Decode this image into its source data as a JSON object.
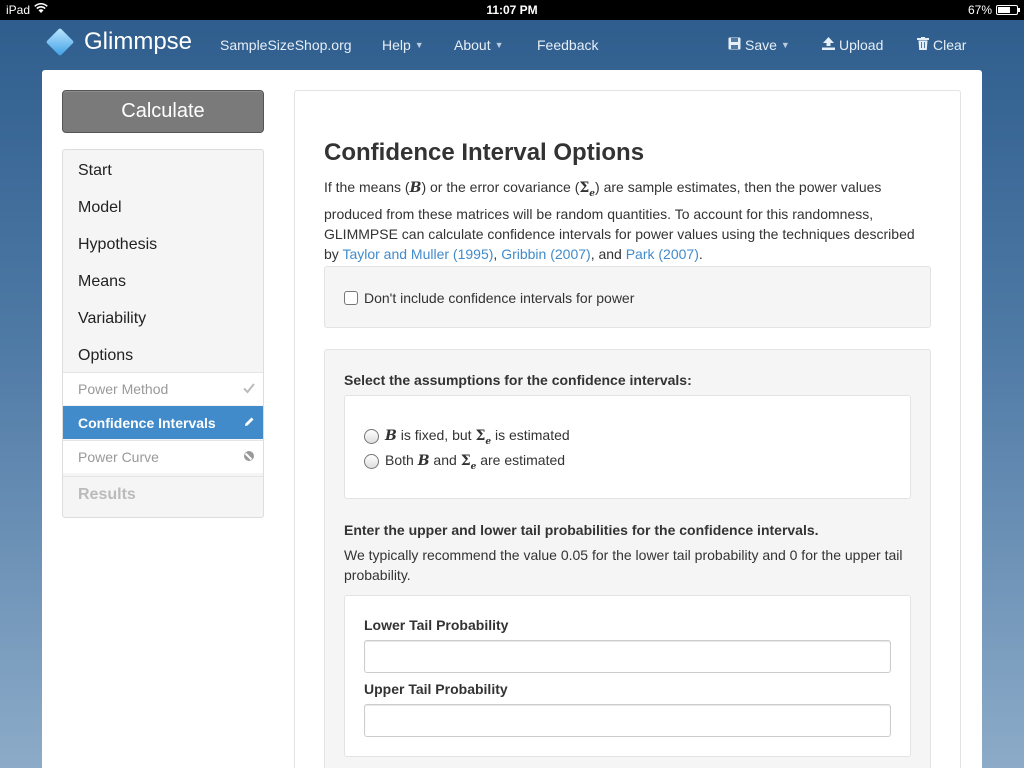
{
  "status_bar": {
    "device": "iPad",
    "time": "11:07 PM",
    "battery": "67%",
    "battery_level": 0.67
  },
  "navbar": {
    "brand": "Glimmpse",
    "links": {
      "site": "SampleSizeShop.org",
      "help": "Help",
      "about": "About",
      "feedback": "Feedback"
    },
    "actions": {
      "save": "Save",
      "upload": "Upload",
      "clear": "Clear"
    }
  },
  "sidebar": {
    "calculate": "Calculate",
    "items": [
      "Start",
      "Model",
      "Hypothesis",
      "Means",
      "Variability",
      "Options"
    ],
    "subitems": {
      "power_method": "Power Method",
      "confidence_intervals": "Confidence Intervals",
      "power_curve": "Power Curve"
    },
    "results": "Results"
  },
  "main": {
    "title": "Confidence Interval Options",
    "intro": {
      "p1": "If the means (",
      "b": "B",
      "p2": ") or the error covariance (",
      "sigma": "Σ",
      "e": "e",
      "p3": ") are sample estimates, then the power values produced from these matrices will be random quantities. To account for this randomness, GLIMMPSE can calculate confidence intervals for power values using the techniques described by ",
      "link1": "Taylor and Muller (1995)",
      "sep1": ", ",
      "link2": "Gribbin (2007)",
      "sep2": ", and ",
      "link3": "Park (2007)",
      "end": "."
    },
    "exclude_checkbox": "Don't include confidence intervals for power",
    "assumptions_heading": "Select the assumptions for the confidence intervals:",
    "option1": {
      "b": "B",
      "mid": " is fixed, but ",
      "sigma": "Σ",
      "e": "e",
      "end": " is estimated"
    },
    "option2": {
      "start": "Both ",
      "b": "B",
      "mid": " and ",
      "sigma": "Σ",
      "e": "e",
      "end": " are estimated"
    },
    "tail_heading": "Enter the upper and lower tail probabilities for the confidence intervals.",
    "tail_help": "We typically recommend the value 0.05 for the lower tail probability and 0 for the upper tail probability.",
    "lower_label": "Lower Tail Probability",
    "lower_value": "",
    "upper_label": "Upper Tail Probability",
    "upper_value": ""
  }
}
